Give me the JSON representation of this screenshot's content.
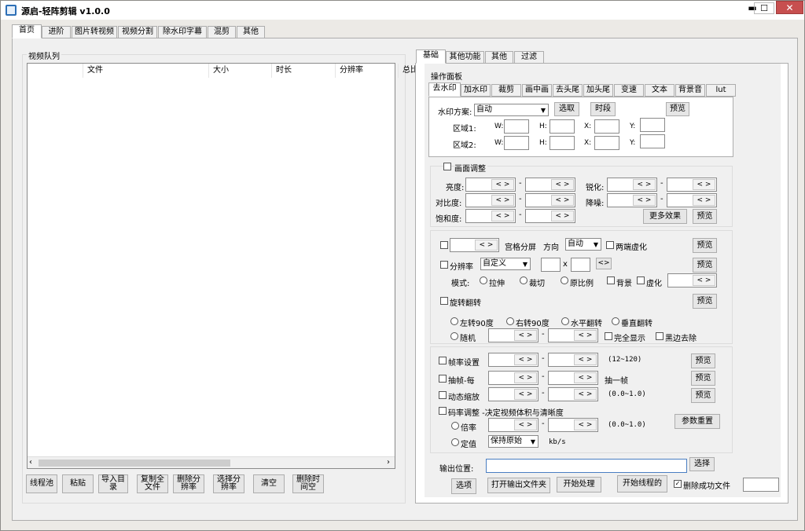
{
  "app": {
    "title": "源启-轻阵剪辑 v1.0.0",
    "min": "▬",
    "max": "☐",
    "close": "✕"
  },
  "main_tabs": [
    "首页",
    "进阶",
    "图片转视频",
    "视频分割",
    "除水印字幕",
    "混剪",
    "其他"
  ],
  "queue": {
    "title": "视频队列",
    "columns": [
      "文件",
      "大小",
      "时长",
      "分辨率",
      "总比"
    ],
    "scroll_left": "‹",
    "scroll_right": "›"
  },
  "bottom_buttons": [
    "线程池",
    "粘贴",
    "导入目录",
    "复制全文件",
    "删除分辨率",
    "选择分辨率",
    "清空",
    "删除时间空"
  ],
  "right_tabs": [
    "基础",
    "其他功能",
    "其他",
    "过滤"
  ],
  "op_panel": {
    "title": "操作面板",
    "tabs": [
      "去水印",
      "加水印",
      "裁剪",
      "画中画",
      "去头尾",
      "加头尾",
      "变速",
      "文本",
      "背景音",
      "lut"
    ]
  },
  "watermark": {
    "scheme_label": "水印方案:",
    "scheme_value": "自动",
    "pick": "选取",
    "period": "时段",
    "preview": "预览",
    "region1": "区域1:",
    "region2": "区域2:",
    "w": "W:",
    "h": "H:",
    "x": "X:",
    "y": "Y:"
  },
  "picture": {
    "title": "画面调整",
    "brightness": "亮度:",
    "contrast": "对比度:",
    "saturation": "饱和度:",
    "sharpen": "锐化:",
    "denoise": "降噪:",
    "more": "更多效果",
    "preview": "预览",
    "arrows": "< >",
    "dash": "-"
  },
  "grid": {
    "label": "宫格分屏",
    "direction": "方向",
    "direction_value": "自动",
    "blur_edges": "两端虚化",
    "preview": "预览",
    "resolution": "分辨率",
    "resolution_value": "自定义",
    "x_sym": "x",
    "swap": "<>",
    "mode": "模式:",
    "stretch": "拉伸",
    "crop": "裁切",
    "original_ratio": "原比例",
    "background": "背景",
    "blur": "虚化"
  },
  "rotate": {
    "label": "旋转翻转",
    "preview": "预览",
    "left90": "左转90度",
    "right90": "右转90度",
    "hflip": "水平翻转",
    "vflip": "垂直翻转",
    "random": "随机",
    "full_display": "完全显示",
    "black_remove": "黑边去除"
  },
  "frame": {
    "fps": "帧率设置",
    "fps_range": "(12~120)",
    "extract": "抽帧-每",
    "extract_one": "抽一帧",
    "zoom": "动态缩放",
    "zoom_range": "(0.0~1.0)",
    "bitrate": "码率调整 -决定视频体积与清晰度",
    "multiplier": "倍率",
    "mult_range": "(0.0~1.0)",
    "fixed": "定值",
    "fixed_value": "保持原始",
    "unit": "kb/s",
    "reset": "参数重置",
    "preview": "预览"
  },
  "output": {
    "label": "输出位置:",
    "choose": "选择",
    "options": "选项",
    "open_folder": "打开输出文件夹",
    "start": "开始处理",
    "start_thread": "开始线程的",
    "delete_success": "删除成功文件"
  }
}
